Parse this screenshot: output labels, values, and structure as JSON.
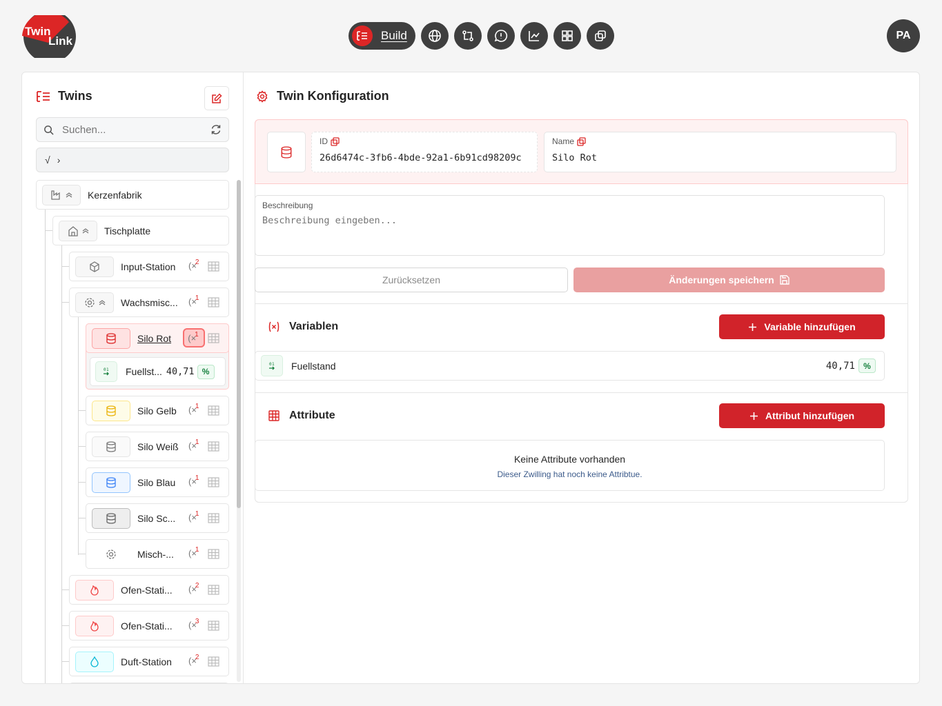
{
  "app": {
    "logo_text_1": "Twin",
    "logo_text_2": "Link",
    "avatar": "PA"
  },
  "nav": {
    "build_label": "Build",
    "icons": [
      "build-icon",
      "globe-icon",
      "git-compare-icon",
      "chat-icon",
      "chart-icon",
      "dashboard-icon",
      "copy-icon"
    ]
  },
  "sidebar": {
    "title": "Twins",
    "search_placeholder": "Suchen...",
    "formula": "√",
    "formula_chevron": "›",
    "tree": {
      "root": "Kerzenfabrik",
      "tischplatte": "Tischplatte",
      "input_station": {
        "label": "Input-Station",
        "vars": "2"
      },
      "wachsmisch": {
        "label": "Wachsmisc...",
        "vars": "1"
      },
      "silo_rot": {
        "label": "Silo Rot",
        "vars": "1"
      },
      "fuellstand": {
        "label": "Fuellst...",
        "value": "40,71",
        "unit": "%"
      },
      "silo_gelb": {
        "label": "Silo Gelb",
        "vars": "1"
      },
      "silo_weiss": {
        "label": "Silo Weiß",
        "vars": "1"
      },
      "silo_blau": {
        "label": "Silo Blau",
        "vars": "1"
      },
      "silo_sc": {
        "label": "Silo Sc...",
        "vars": "1"
      },
      "misch": {
        "label": "Misch-...",
        "vars": "1"
      },
      "ofen1": {
        "label": "Ofen-Stati...",
        "vars": "2"
      },
      "ofen2": {
        "label": "Ofen-Stati...",
        "vars": "3"
      },
      "duft": {
        "label": "Duft-Station",
        "vars": "2"
      }
    }
  },
  "config": {
    "title": "Twin Konfiguration",
    "id_label": "ID",
    "id_value": "26d6474c-3fb6-4bde-92a1-6b91cd98209c",
    "name_label": "Name",
    "name_value": "Silo Rot",
    "desc_label": "Beschreibung",
    "desc_placeholder": "Beschreibung eingeben...",
    "reset_label": "Zurücksetzen",
    "save_label": "Änderungen speichern"
  },
  "variables": {
    "title": "Variablen",
    "add_label": "Variable hinzufügen",
    "items": [
      {
        "name": "Fuellstand",
        "value": "40,71",
        "unit": "%"
      }
    ]
  },
  "attributes": {
    "title": "Attribute",
    "add_label": "Attribut hinzufügen",
    "empty_title": "Keine Attribute vorhanden",
    "empty_text": "Dieser Zwilling hat noch keine Attribtue."
  },
  "colors": {
    "accent": "#d1232a",
    "dark": "#3f3f3f",
    "save_disabled": "#e9a0a0",
    "green": "#15803d"
  }
}
